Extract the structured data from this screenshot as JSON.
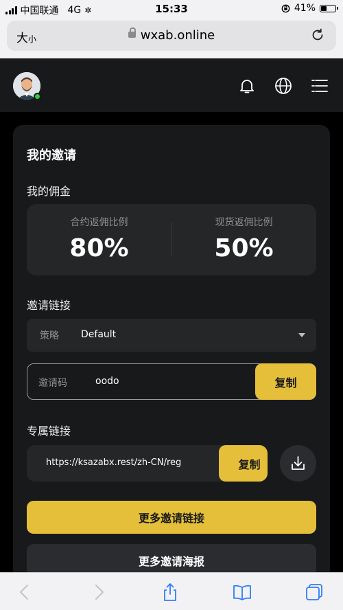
{
  "status_bar": {
    "carrier": "中国联通",
    "network": "4G",
    "time": "15:33",
    "battery": "41%",
    "battery_level": 0.41
  },
  "browser": {
    "text_size_label": "大",
    "text_size_small": "小",
    "url": "wxab.online"
  },
  "header": {
    "avatar_icon": "avatar-icon",
    "bell_icon": "bell-icon",
    "globe_icon": "globe-icon",
    "menu_icon": "menu-icon",
    "online_color": "#2ecc40"
  },
  "invite": {
    "title": "我的邀请",
    "commission_label": "我的佣金",
    "contract_label": "合约返佣比例",
    "contract_value": "80%",
    "spot_label": "现货返佣比例",
    "spot_value": "50%",
    "link_section_label": "邀请链接",
    "strategy_label": "策略",
    "strategy_value": "Default",
    "code_label": "邀请码",
    "code_value": "oodo",
    "copy_label": "复制",
    "exclusive_label": "专属链接",
    "exclusive_url": "https://ksazabx.rest/zh-CN/register?inviteCode=oodo",
    "more_links": "更多邀请链接",
    "more_posters": "更多邀请海报"
  },
  "colors": {
    "accent": "#e5bf3a",
    "card_bg": "#18191b",
    "panel_bg": "#252628"
  }
}
